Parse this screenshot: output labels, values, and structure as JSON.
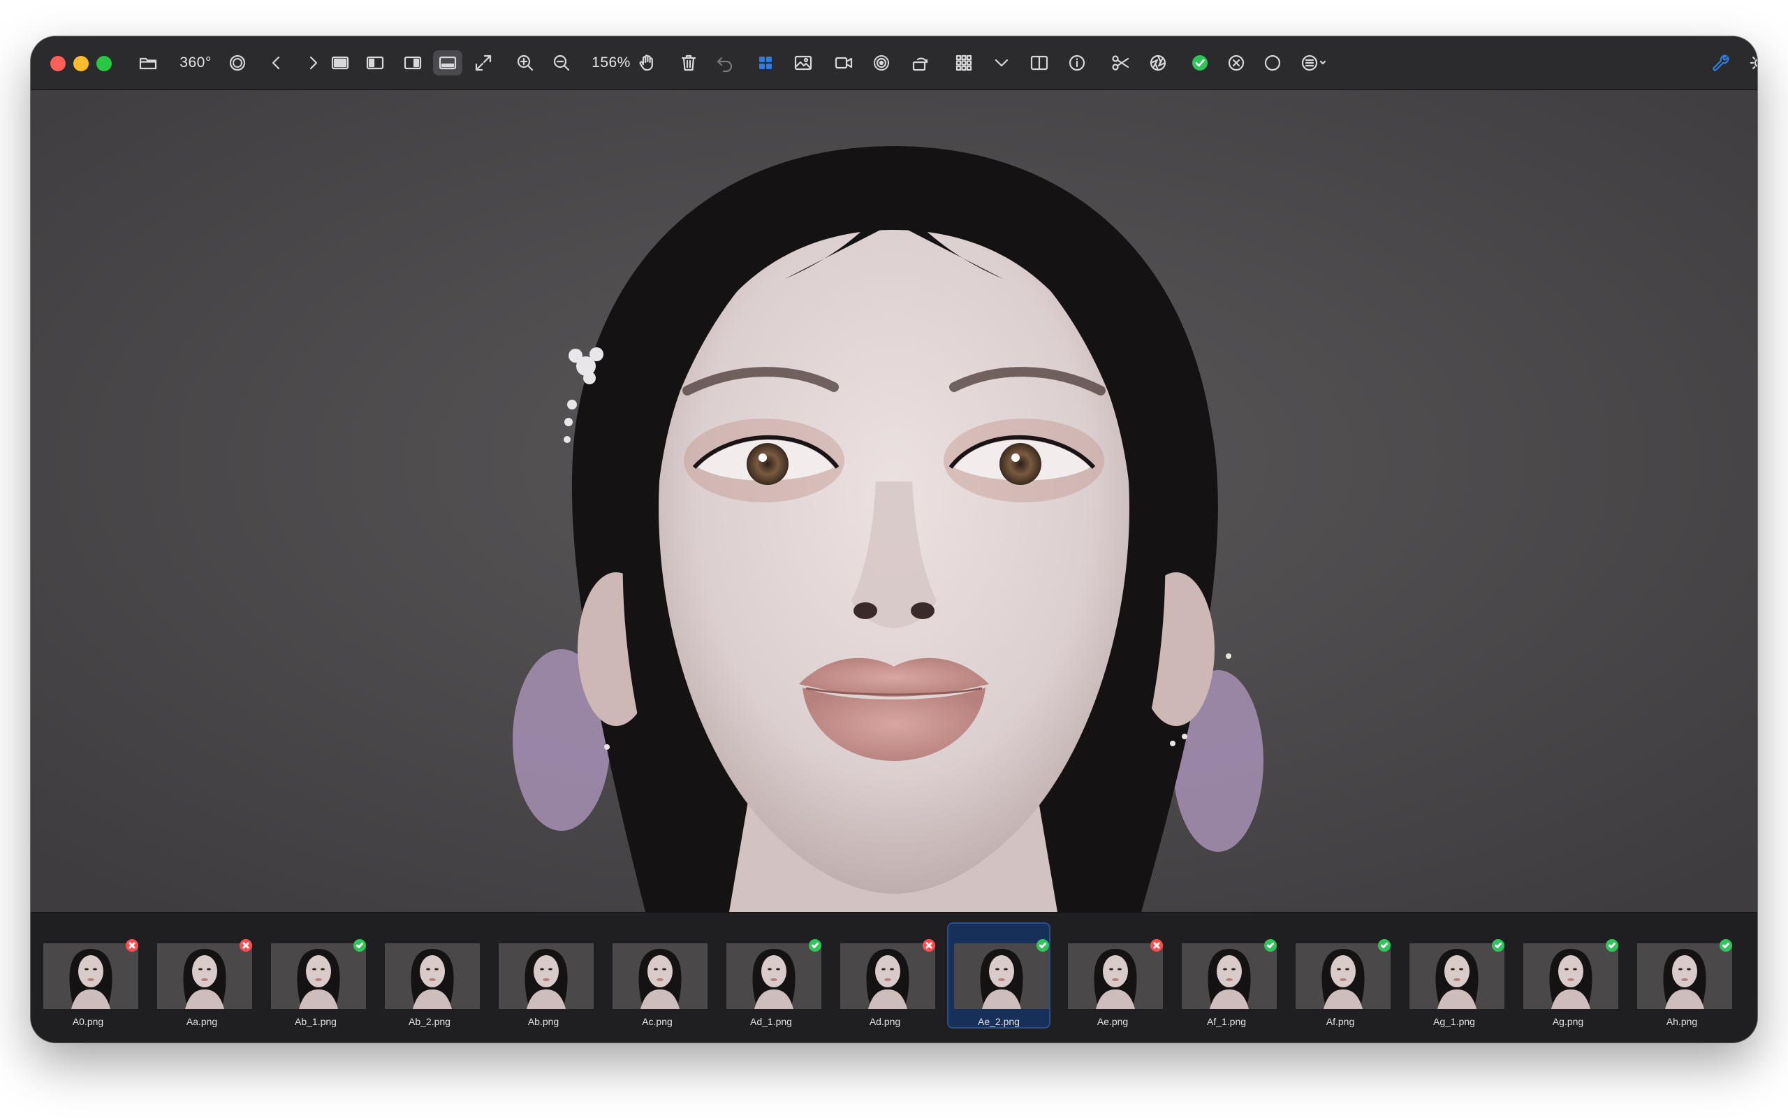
{
  "toolbar": {
    "view_360_label": "360°",
    "zoom_level": "156%",
    "accent_color": "#2f7de1",
    "approve_color": "#2fc55a",
    "icons": [
      "folder-icon",
      "smiley-icon",
      "chevron-left-icon",
      "chevron-right-icon",
      "view-single-icon",
      "view-left-panel-icon",
      "view-right-panel-icon",
      "view-filmstrip-icon",
      "fullscreen-expand-icon",
      "zoom-in-icon",
      "zoom-out-icon",
      "hand-pan-icon",
      "trash-icon",
      "undo-icon",
      "grid-view-icon",
      "image-icon",
      "video-icon",
      "live-photo-icon",
      "rotate-icon",
      "thumbnail-grid-icon",
      "chevron-down-icon",
      "compare-split-icon",
      "info-icon",
      "scissors-icon",
      "aperture-icon",
      "approve-check-icon",
      "reject-x-icon",
      "circle-icon",
      "menu-options-icon",
      "wrench-icon",
      "brightness-icon"
    ]
  },
  "filmstrip": {
    "selected_index": 8,
    "items": [
      {
        "name": "A0.png",
        "status": "rejected"
      },
      {
        "name": "Aa.png",
        "status": "rejected"
      },
      {
        "name": "Ab_1.png",
        "status": "approved"
      },
      {
        "name": "Ab_2.png",
        "status": "none"
      },
      {
        "name": "Ab.png",
        "status": "none"
      },
      {
        "name": "Ac.png",
        "status": "none"
      },
      {
        "name": "Ad_1.png",
        "status": "approved"
      },
      {
        "name": "Ad.png",
        "status": "rejected"
      },
      {
        "name": "Ae_2.png",
        "status": "approved"
      },
      {
        "name": "Ae.png",
        "status": "rejected"
      },
      {
        "name": "Af_1.png",
        "status": "approved"
      },
      {
        "name": "Af.png",
        "status": "approved"
      },
      {
        "name": "Ag_1.png",
        "status": "approved"
      },
      {
        "name": "Ag.png",
        "status": "approved"
      },
      {
        "name": "Ah.png",
        "status": "approved"
      }
    ]
  },
  "colors": {
    "rejected": "#ff4d4f",
    "approved": "#2fc55a"
  }
}
